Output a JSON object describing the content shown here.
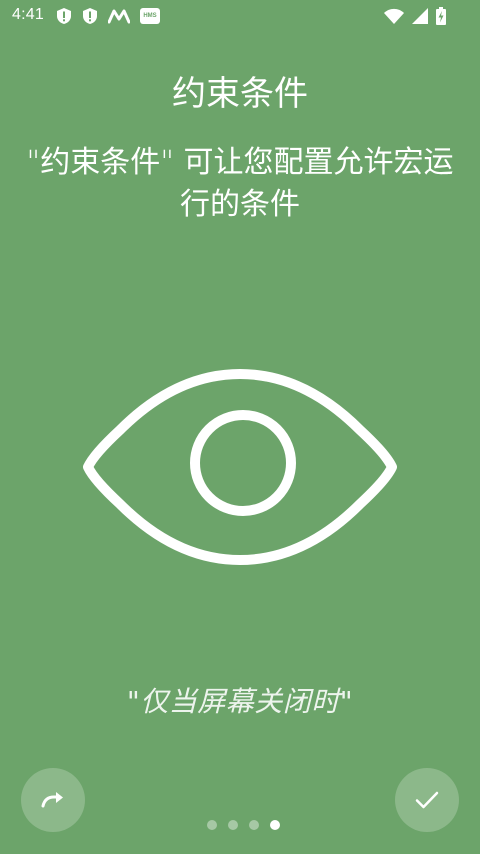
{
  "status_bar": {
    "time": "4:41",
    "left_icons": [
      "shield-alert-icon",
      "shield-alert-icon",
      "m-logo-icon",
      "hms-badge-icon"
    ],
    "hms_label": "HMS",
    "right_icons": [
      "wifi-icon",
      "signal-icon",
      "battery-charging-icon"
    ]
  },
  "onboarding": {
    "title": "约束条件",
    "subtitle": "\"约束条件\" 可让您配置允许宏运行的条件",
    "illustration": "eye-icon",
    "quote": "\"仅当屏幕关闭时\""
  },
  "navigation": {
    "skip_icon": "redo-arrow-icon",
    "done_icon": "checkmark-icon",
    "page_count": 4,
    "current_page": 4
  },
  "colors": {
    "background": "#6ca46a",
    "foreground": "#ffffff"
  }
}
